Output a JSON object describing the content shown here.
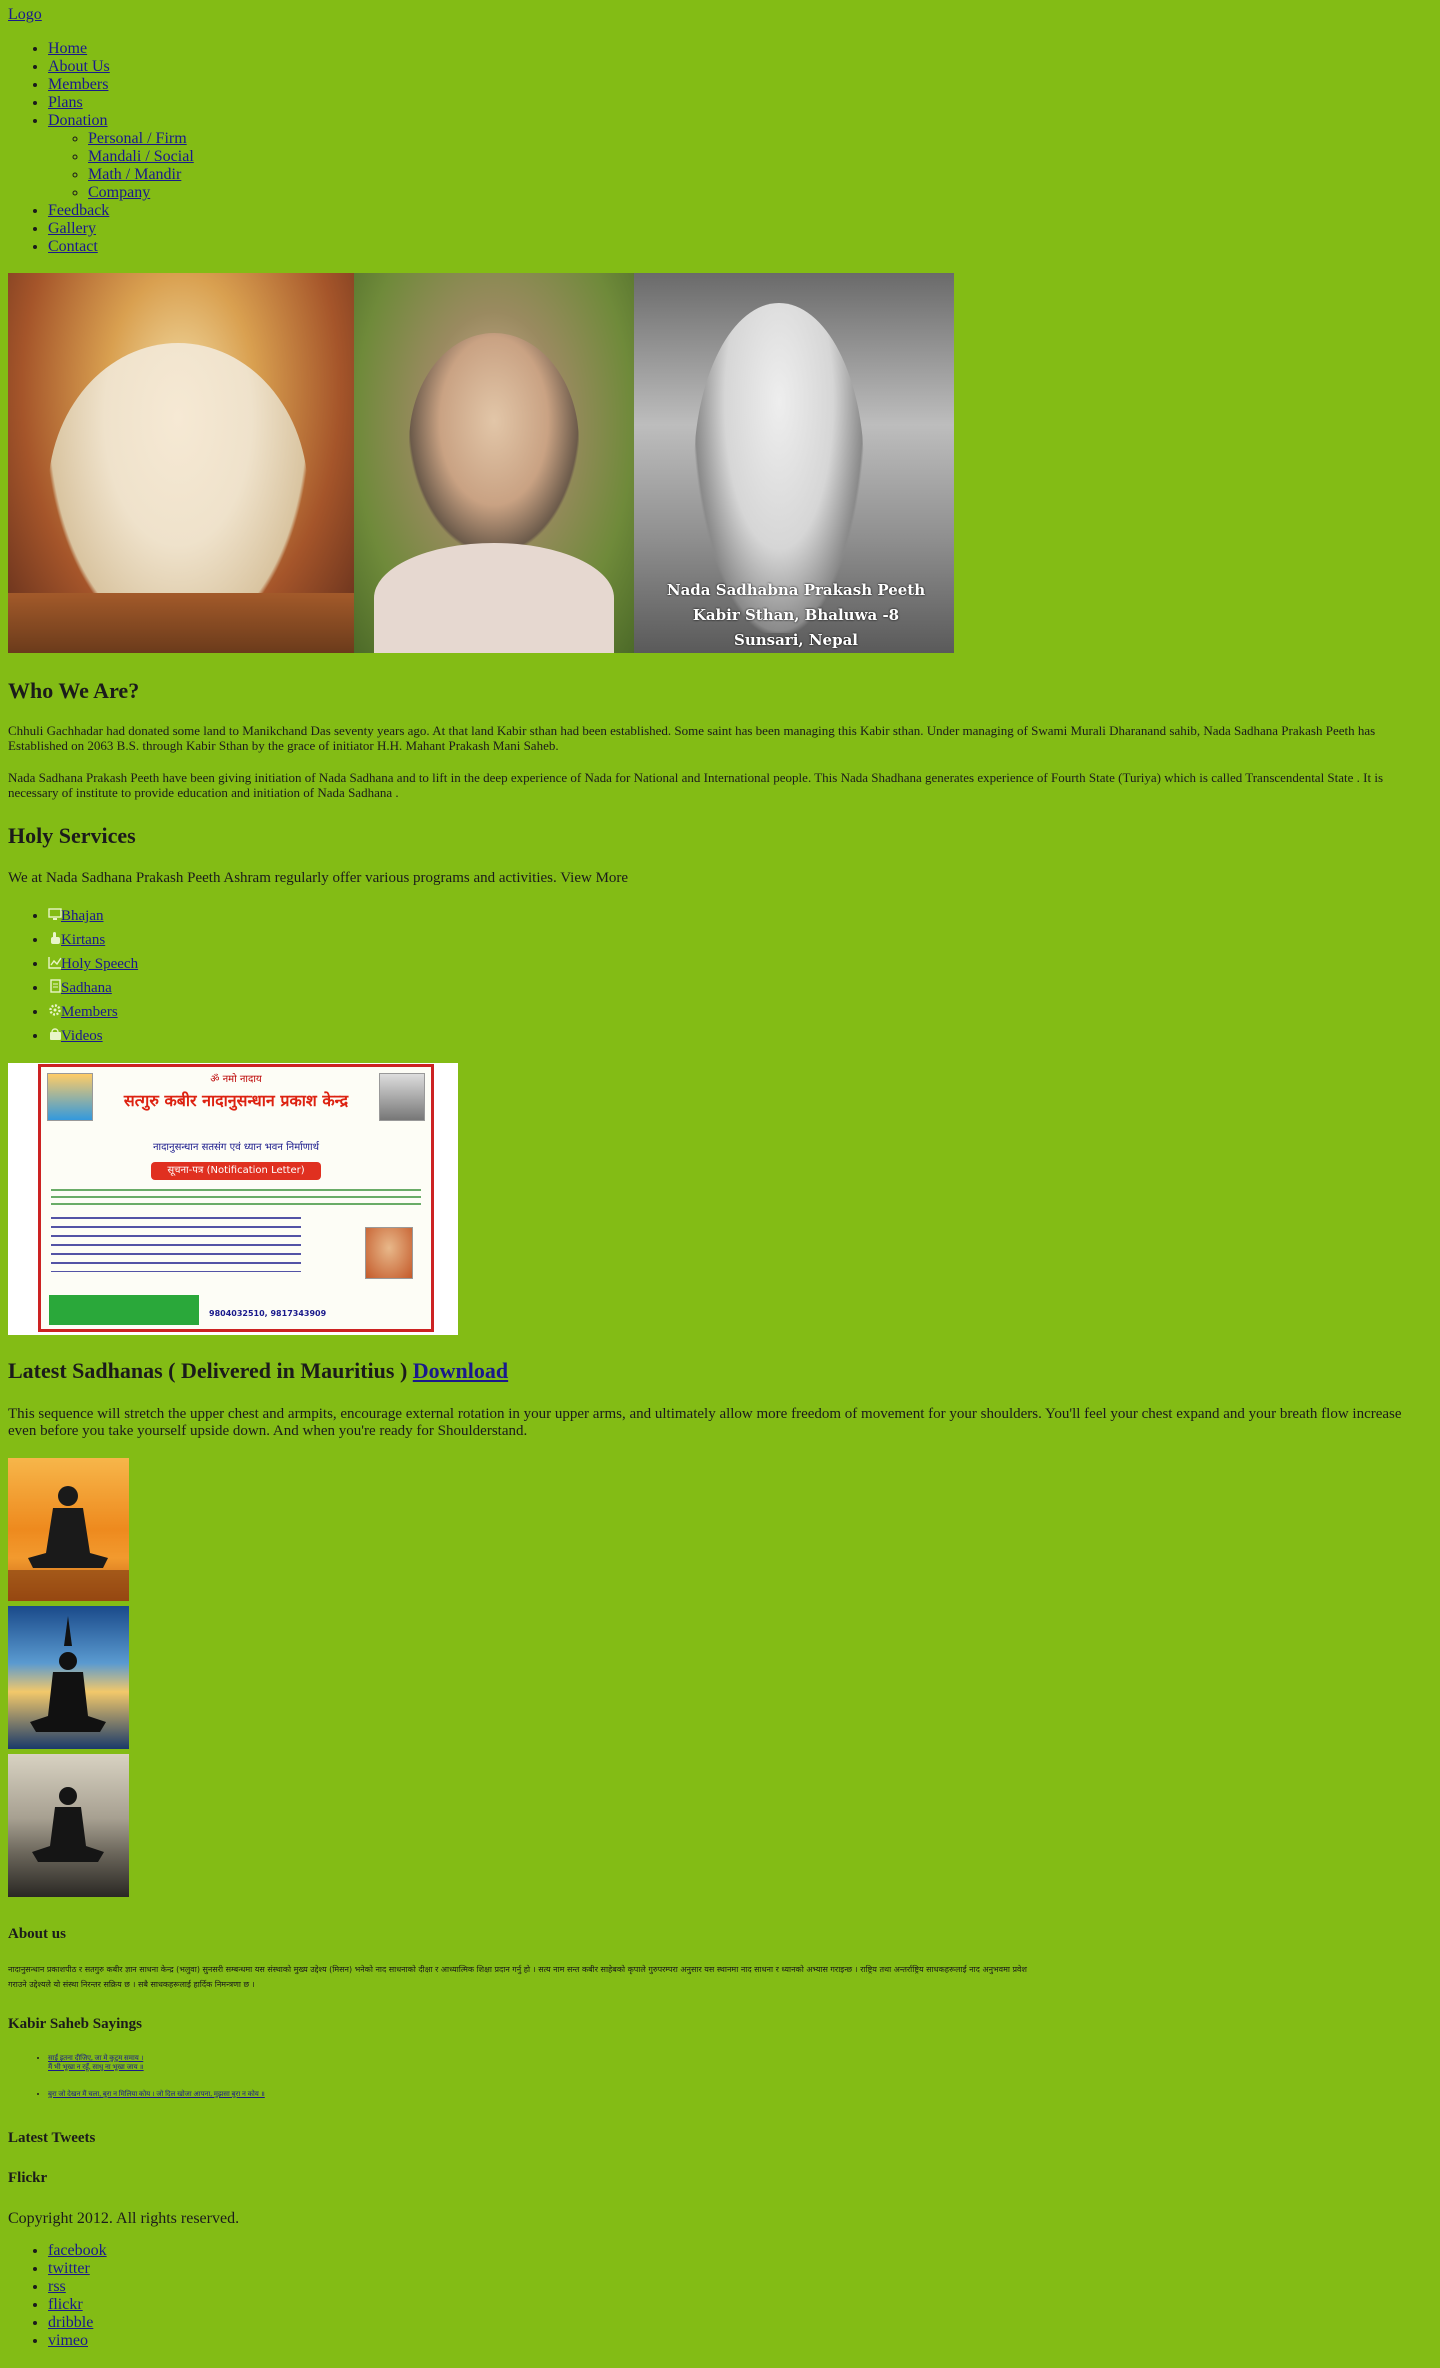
{
  "logo": "Logo",
  "nav": {
    "home": "Home",
    "about": "About Us",
    "members": "Members",
    "plans": "Plans",
    "donation": "Donation",
    "donation_sub": [
      "Personal / Firm",
      "Mandali / Social",
      "Math / Mandir",
      "Company"
    ],
    "feedback": "Feedback",
    "gallery": "Gallery",
    "contact": "Contact"
  },
  "banner": {
    "caption_line1": "Nada Sadhabna Prakash Peeth",
    "caption_line2": "Kabir Sthan, Bhaluwa -8",
    "caption_line3": "Sunsari, Nepal"
  },
  "who": {
    "title": "Who We Are?",
    "para1": "Chhuli Gachhadar had donated some land  to  Manikchand  Das seventy years ago. At that land Kabir sthan had been established. Some saint  has been managing this  Kabir sthan. Under managing of Swami Murali Dharanand sahib, Nada Sadhana Prakash Peeth has Established on 2063 B.S. through Kabir Sthan by the grace of initiator  H.H. Mahant Prakash Mani Saheb.",
    "para2": "Nada Sadhana Prakash Peeth have been giving initiation of Nada Sadhana and to lift in the deep experience of Nada for National and International people. This Nada Shadhana generates experience of Fourth State (Turiya) which is called Transcendental State . It is necessary of institute to provide education and initiation of Nada Sadhana ."
  },
  "services": {
    "title": "Holy Services",
    "intro": "We at Nada Sadhana Prakash Peeth Ashram regularly offer various programs and activities.",
    "view_more": "View More",
    "items": [
      {
        "label": "Bhajan",
        "icon": "monitor-icon"
      },
      {
        "label": "Kirtans",
        "icon": "hand-icon"
      },
      {
        "label": "Holy Speech",
        "icon": "chart-icon"
      },
      {
        "label": "Sadhana",
        "icon": "document-icon"
      },
      {
        "label": "Members",
        "icon": "gear-icon"
      },
      {
        "label": "Videos",
        "icon": "bag-icon"
      }
    ]
  },
  "notice": {
    "top": "ॐ नमो नादाय",
    "title": "सत्गुरु कबीर नादानुसन्धान प्रकाश केन्द्र",
    "subtitle": "नादानुसन्धान सतसंग एवं ध्यान भवन निर्माणार्थ",
    "band": "सूचना-पत्र (Notification Letter)",
    "phone": "9804032510, 9817343909"
  },
  "latest": {
    "title": "Latest Sadhanas ( Delivered in Mauritius )",
    "download": "Download",
    "body": "This sequence will stretch the upper chest and armpits, encourage external rotation in your upper arms, and ultimately allow more freedom of movement for your shoulders. You'll feel your chest expand and your breath flow increase even before you take yourself upside down. And when you're ready for Shoulderstand."
  },
  "footer": {
    "about_title": "About us",
    "about_text": "नादानुसन्धान प्रकाशपीठ र सतगुरु कबीर ज्ञान साधना केन्द्र (भलुवा) सुनसरी सम्बन्धमा यस संस्थाको मुख्य उद्देश्य (मिसन) भनेको नाद साधनाको दीक्षा र आध्यात्मिक शिक्षा प्रदान गर्नु हो । सत्य नाम सन्त कबीर साहेबको कृपाले गुरुपरम्परा अनुसार यस स्थानमा नाद साधना र ध्यानको अभ्यास गराइन्छ । राष्ट्रिय तथा अन्तर्राष्ट्रिय साधकहरूलाई नाद अनुभवमा प्रवेश गराउने उद्देश्यले यो संस्था निरन्तर सक्रिय छ । सबै साधकहरूलाई हार्दिक निमन्त्रणा छ ।",
    "sayings_title": "Kabir Saheb Sayings",
    "sayings": [
      {
        "line1": "साईं इतना दीजिए, जा मे कुटुम समाय ।",
        "line2": "मैं भी भूखा न रहूँ, साधु ना भूखा जाय ॥"
      },
      {
        "line1": "बुरा जो देखन मैं चला, बुरा न मिलिया कोय । जो दिल खोजा आपना, मुझसा बुरा न कोय ॥",
        "line2": ""
      }
    ],
    "tweets_title": "Latest Tweets",
    "flickr_title": "Flickr",
    "copyright": "Copyright 2012. All rights reserved.",
    "social": [
      "facebook",
      "twitter",
      "rss",
      "flickr",
      "dribble",
      "vimeo"
    ]
  }
}
